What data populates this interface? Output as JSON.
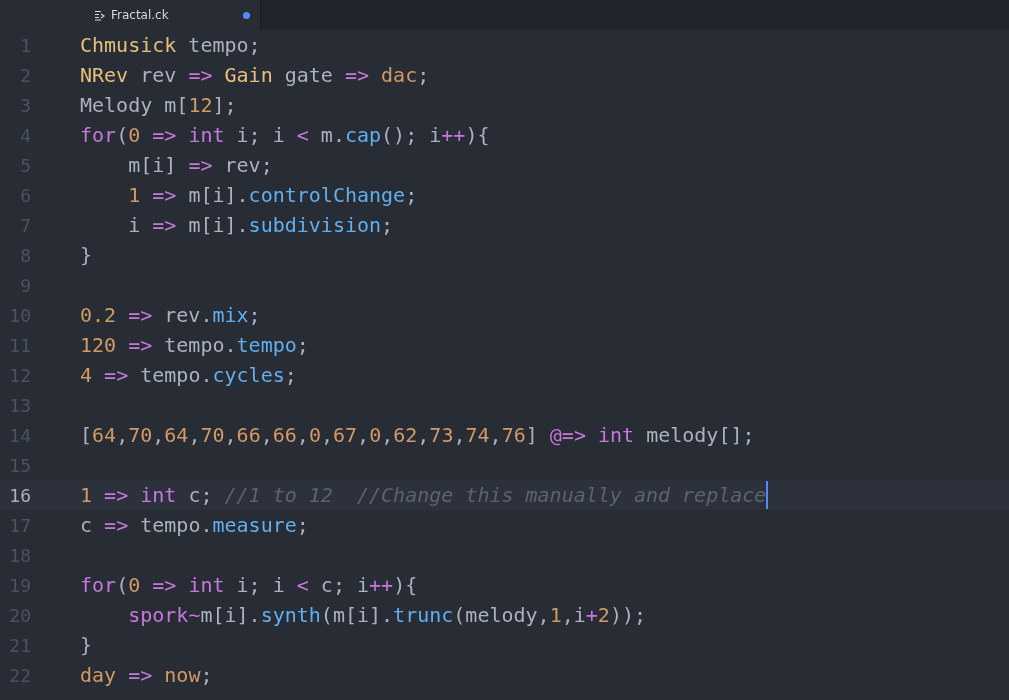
{
  "tab": {
    "label": "Fractal.ck",
    "modified": true
  },
  "lines": [
    {
      "number": "1",
      "active": false,
      "tokens": [
        {
          "kind": "type",
          "text": "Chmusick"
        },
        {
          "kind": "plain",
          "text": " tempo;"
        }
      ]
    },
    {
      "number": "2",
      "active": false,
      "tokens": [
        {
          "kind": "type",
          "text": "NRev"
        },
        {
          "kind": "plain",
          "text": " rev "
        },
        {
          "kind": "operator",
          "text": "=> "
        },
        {
          "kind": "type",
          "text": "Gain"
        },
        {
          "kind": "plain",
          "text": " gate "
        },
        {
          "kind": "operator",
          "text": "=> "
        },
        {
          "kind": "constant",
          "text": "dac"
        },
        {
          "kind": "plain",
          "text": ";"
        }
      ]
    },
    {
      "number": "3",
      "active": false,
      "tokens": [
        {
          "kind": "plain",
          "text": "Melody m["
        },
        {
          "kind": "number",
          "text": "12"
        },
        {
          "kind": "plain",
          "text": "];"
        }
      ]
    },
    {
      "number": "4",
      "active": false,
      "tokens": [
        {
          "kind": "keyword",
          "text": "for"
        },
        {
          "kind": "plain",
          "text": "("
        },
        {
          "kind": "number",
          "text": "0"
        },
        {
          "kind": "operator",
          "text": " => "
        },
        {
          "kind": "keyword",
          "text": "int"
        },
        {
          "kind": "plain",
          "text": " i; i "
        },
        {
          "kind": "operator",
          "text": "<"
        },
        {
          "kind": "plain",
          "text": " m."
        },
        {
          "kind": "function",
          "text": "cap"
        },
        {
          "kind": "plain",
          "text": "(); i"
        },
        {
          "kind": "operator",
          "text": "++"
        },
        {
          "kind": "plain",
          "text": "){"
        }
      ]
    },
    {
      "number": "5",
      "active": false,
      "tokens": [
        {
          "kind": "plain",
          "text": "    m[i] "
        },
        {
          "kind": "operator",
          "text": "=>"
        },
        {
          "kind": "plain",
          "text": " rev;"
        }
      ]
    },
    {
      "number": "6",
      "active": false,
      "tokens": [
        {
          "kind": "number",
          "text": "    1"
        },
        {
          "kind": "operator",
          "text": " =>"
        },
        {
          "kind": "plain",
          "text": " m[i]."
        },
        {
          "kind": "function",
          "text": "controlChange"
        },
        {
          "kind": "plain",
          "text": ";"
        }
      ]
    },
    {
      "number": "7",
      "active": false,
      "tokens": [
        {
          "kind": "plain",
          "text": "    i "
        },
        {
          "kind": "operator",
          "text": "=>"
        },
        {
          "kind": "plain",
          "text": " m[i]."
        },
        {
          "kind": "function",
          "text": "subdivision"
        },
        {
          "kind": "plain",
          "text": ";"
        }
      ]
    },
    {
      "number": "8",
      "active": false,
      "tokens": [
        {
          "kind": "plain",
          "text": "}"
        }
      ]
    },
    {
      "number": "9",
      "active": false
    },
    {
      "number": "10",
      "active": false,
      "tokens": [
        {
          "kind": "number",
          "text": "0.2"
        },
        {
          "kind": "operator",
          "text": " =>"
        },
        {
          "kind": "plain",
          "text": " rev."
        },
        {
          "kind": "function",
          "text": "mix"
        },
        {
          "kind": "plain",
          "text": ";"
        }
      ]
    },
    {
      "number": "11",
      "active": false,
      "tokens": [
        {
          "kind": "number",
          "text": "120"
        },
        {
          "kind": "operator",
          "text": " =>"
        },
        {
          "kind": "plain",
          "text": " tempo."
        },
        {
          "kind": "function",
          "text": "tempo"
        },
        {
          "kind": "plain",
          "text": ";"
        }
      ]
    },
    {
      "number": "12",
      "active": false,
      "tokens": [
        {
          "kind": "number",
          "text": "4"
        },
        {
          "kind": "operator",
          "text": " =>"
        },
        {
          "kind": "plain",
          "text": " tempo."
        },
        {
          "kind": "function",
          "text": "cycles"
        },
        {
          "kind": "plain",
          "text": ";"
        }
      ]
    },
    {
      "number": "13",
      "active": false
    },
    {
      "number": "14",
      "active": false,
      "tokens": [
        {
          "kind": "plain",
          "text": "["
        },
        {
          "kind": "number",
          "text": "64"
        },
        {
          "kind": "plain",
          "text": ","
        },
        {
          "kind": "number",
          "text": "70"
        },
        {
          "kind": "plain",
          "text": ","
        },
        {
          "kind": "number",
          "text": "64"
        },
        {
          "kind": "plain",
          "text": ","
        },
        {
          "kind": "number",
          "text": "70"
        },
        {
          "kind": "plain",
          "text": ","
        },
        {
          "kind": "number",
          "text": "66"
        },
        {
          "kind": "plain",
          "text": ","
        },
        {
          "kind": "number",
          "text": "66"
        },
        {
          "kind": "plain",
          "text": ","
        },
        {
          "kind": "number",
          "text": "0"
        },
        {
          "kind": "plain",
          "text": ","
        },
        {
          "kind": "number",
          "text": "67"
        },
        {
          "kind": "plain",
          "text": ","
        },
        {
          "kind": "number",
          "text": "0"
        },
        {
          "kind": "plain",
          "text": ","
        },
        {
          "kind": "number",
          "text": "62"
        },
        {
          "kind": "plain",
          "text": ","
        },
        {
          "kind": "number",
          "text": "73"
        },
        {
          "kind": "plain",
          "text": ","
        },
        {
          "kind": "number",
          "text": "74"
        },
        {
          "kind": "plain",
          "text": ","
        },
        {
          "kind": "number",
          "text": "76"
        },
        {
          "kind": "plain",
          "text": "] "
        },
        {
          "kind": "operator",
          "text": "@=> "
        },
        {
          "kind": "keyword",
          "text": "int"
        },
        {
          "kind": "plain",
          "text": " melody[];"
        }
      ]
    },
    {
      "number": "15",
      "active": false
    },
    {
      "number": "16",
      "active": true,
      "cursor": true,
      "tokens": [
        {
          "kind": "number",
          "text": "1"
        },
        {
          "kind": "operator",
          "text": " => "
        },
        {
          "kind": "keyword",
          "text": "int"
        },
        {
          "kind": "plain",
          "text": " c; "
        },
        {
          "kind": "comment",
          "text": "//1 to 12  //Change this manually and replace"
        }
      ]
    },
    {
      "number": "17",
      "active": false,
      "tokens": [
        {
          "kind": "plain",
          "text": "c "
        },
        {
          "kind": "operator",
          "text": "=>"
        },
        {
          "kind": "plain",
          "text": " tempo."
        },
        {
          "kind": "function",
          "text": "measure"
        },
        {
          "kind": "plain",
          "text": ";"
        }
      ]
    },
    {
      "number": "18",
      "active": false
    },
    {
      "number": "19",
      "active": false,
      "tokens": [
        {
          "kind": "keyword",
          "text": "for"
        },
        {
          "kind": "plain",
          "text": "("
        },
        {
          "kind": "number",
          "text": "0"
        },
        {
          "kind": "operator",
          "text": " => "
        },
        {
          "kind": "keyword",
          "text": "int"
        },
        {
          "kind": "plain",
          "text": " i; i "
        },
        {
          "kind": "operator",
          "text": "<"
        },
        {
          "kind": "plain",
          "text": " c; i"
        },
        {
          "kind": "operator",
          "text": "++"
        },
        {
          "kind": "plain",
          "text": "){"
        }
      ]
    },
    {
      "number": "20",
      "active": false,
      "tokens": [
        {
          "kind": "keyword",
          "text": "    spork"
        },
        {
          "kind": "operator",
          "text": "~"
        },
        {
          "kind": "plain",
          "text": "m[i]."
        },
        {
          "kind": "function",
          "text": "synth"
        },
        {
          "kind": "plain",
          "text": "(m[i]."
        },
        {
          "kind": "function",
          "text": "trunc"
        },
        {
          "kind": "plain",
          "text": "(melody,"
        },
        {
          "kind": "number",
          "text": "1"
        },
        {
          "kind": "plain",
          "text": ",i"
        },
        {
          "kind": "operator",
          "text": "+"
        },
        {
          "kind": "number",
          "text": "2"
        },
        {
          "kind": "plain",
          "text": "));"
        }
      ]
    },
    {
      "number": "21",
      "active": false,
      "tokens": [
        {
          "kind": "plain",
          "text": "}"
        }
      ]
    },
    {
      "number": "22",
      "active": false,
      "tokens": [
        {
          "kind": "constant",
          "text": "day"
        },
        {
          "kind": "operator",
          "text": " => "
        },
        {
          "kind": "constant",
          "text": "now"
        },
        {
          "kind": "plain",
          "text": ";"
        }
      ]
    }
  ]
}
